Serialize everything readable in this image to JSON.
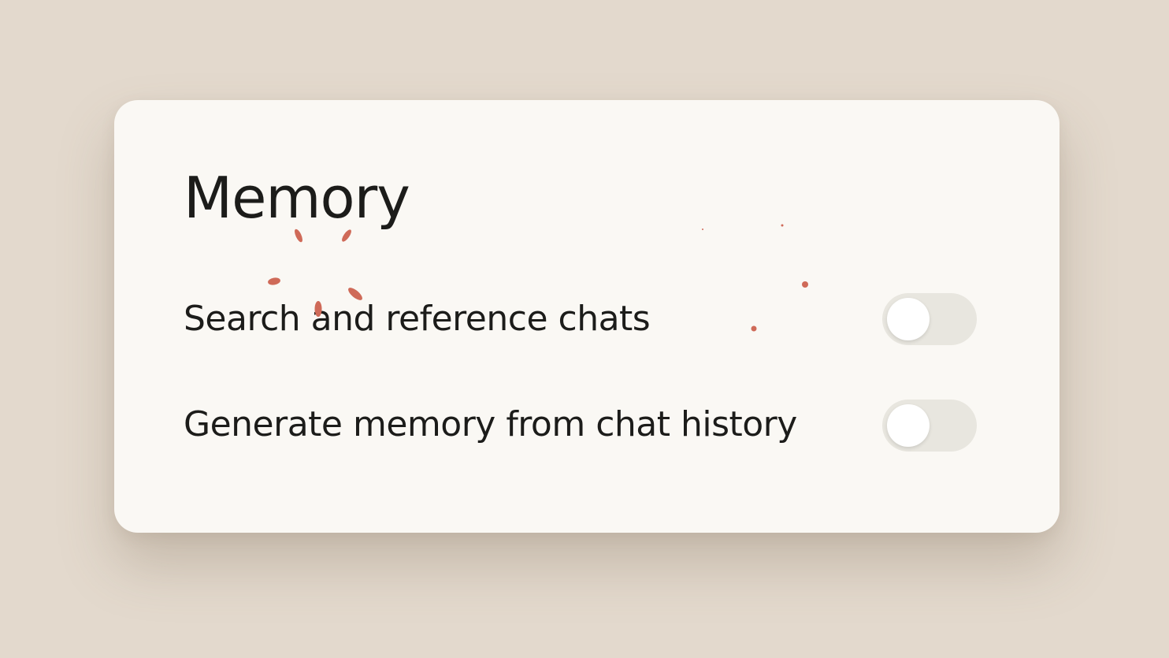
{
  "card": {
    "title": "Memory",
    "settings": [
      {
        "label": "Search and reference chats",
        "enabled": false
      },
      {
        "label": "Generate memory from chat history",
        "enabled": false
      }
    ]
  },
  "colors": {
    "background": "#e3d9cd",
    "card": "#faf8f4",
    "text": "#1c1c1a",
    "toggle_off_track": "#e8e6df",
    "toggle_knob": "#ffffff",
    "sparkle_accent": "#cf6a58"
  }
}
